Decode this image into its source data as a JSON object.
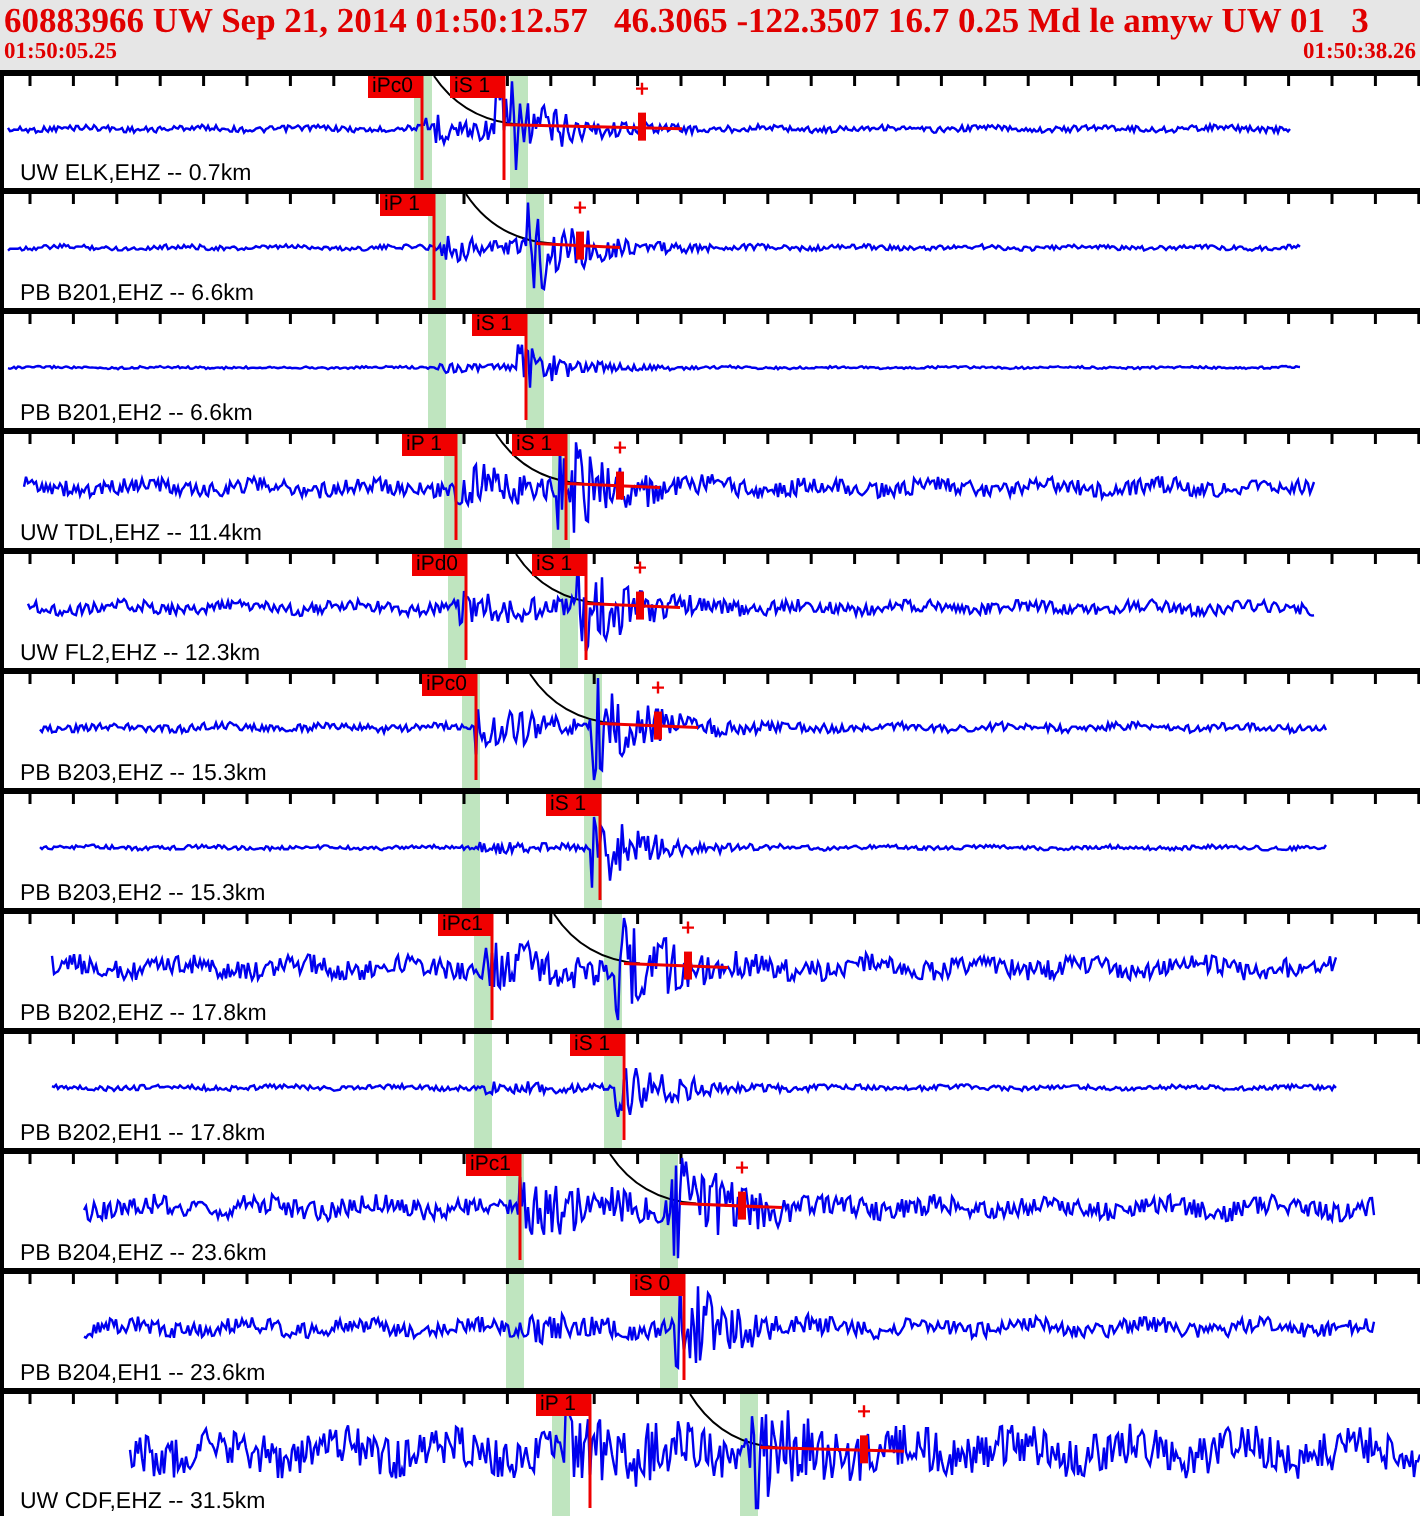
{
  "header": {
    "title": "60883966 UW Sep 21, 2014 01:50:12.57   46.3065 -122.3507 16.7 0.25 Md le amyw UW 01   3",
    "start_time": "01:50:05.25",
    "end_time": "01:50:38.26"
  },
  "traces": [
    {
      "station": "UW ELK,EHZ -- 0.7km",
      "picks": [
        "iPc0",
        "iS 1"
      ]
    },
    {
      "station": "PB B201,EHZ -- 6.6km",
      "picks": [
        "iP 1"
      ]
    },
    {
      "station": "PB B201,EH2 -- 6.6km",
      "picks": [
        "iS 1"
      ]
    },
    {
      "station": "UW TDL,EHZ -- 11.4km",
      "picks": [
        "iP 1",
        "iS 1"
      ]
    },
    {
      "station": "UW FL2,EHZ -- 12.3km",
      "picks": [
        "iPd0",
        "iS 1"
      ]
    },
    {
      "station": "PB B203,EHZ -- 15.3km",
      "picks": [
        "iPc0"
      ]
    },
    {
      "station": "PB B203,EH2 -- 15.3km",
      "picks": [
        "iS 1"
      ]
    },
    {
      "station": "PB B202,EHZ -- 17.8km",
      "picks": [
        "iPc1"
      ]
    },
    {
      "station": "PB B202,EH1 -- 17.8km",
      "picks": [
        "iS 1"
      ]
    },
    {
      "station": "PB B204,EHZ -- 23.6km",
      "picks": [
        "iPc1"
      ]
    },
    {
      "station": "PB B204,EH1 -- 23.6km",
      "picks": [
        "iS 0"
      ]
    },
    {
      "station": "UW CDF,EHZ -- 31.5km",
      "picks": [
        "iP 1"
      ]
    }
  ]
}
